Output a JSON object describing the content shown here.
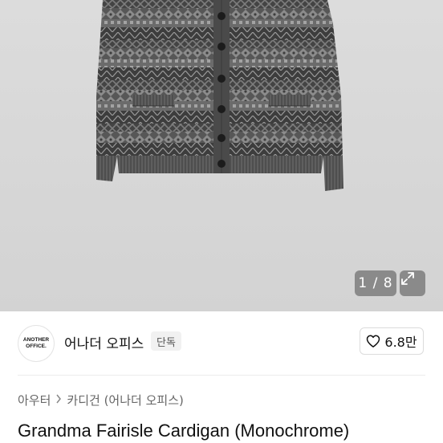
{
  "gallery": {
    "counter": "1 / 8",
    "expand_icon": "expand-icon"
  },
  "brand": {
    "logo_line1": "ANOTHER",
    "logo_line2": "OFFICE.",
    "name": "어나더 오피스",
    "badge": "단독"
  },
  "like": {
    "icon": "heart-icon",
    "count": "6.8만"
  },
  "breadcrumb": {
    "first": "아우터",
    "second": "카디건 (어나더 오피스)"
  },
  "product": {
    "title": "Grandma Fairisle Cardigan (Monochrome)"
  },
  "colors": {
    "background": "#dcdcdc",
    "knit_dark": "#4a4a4a",
    "knit_light": "#8a8a8a"
  }
}
